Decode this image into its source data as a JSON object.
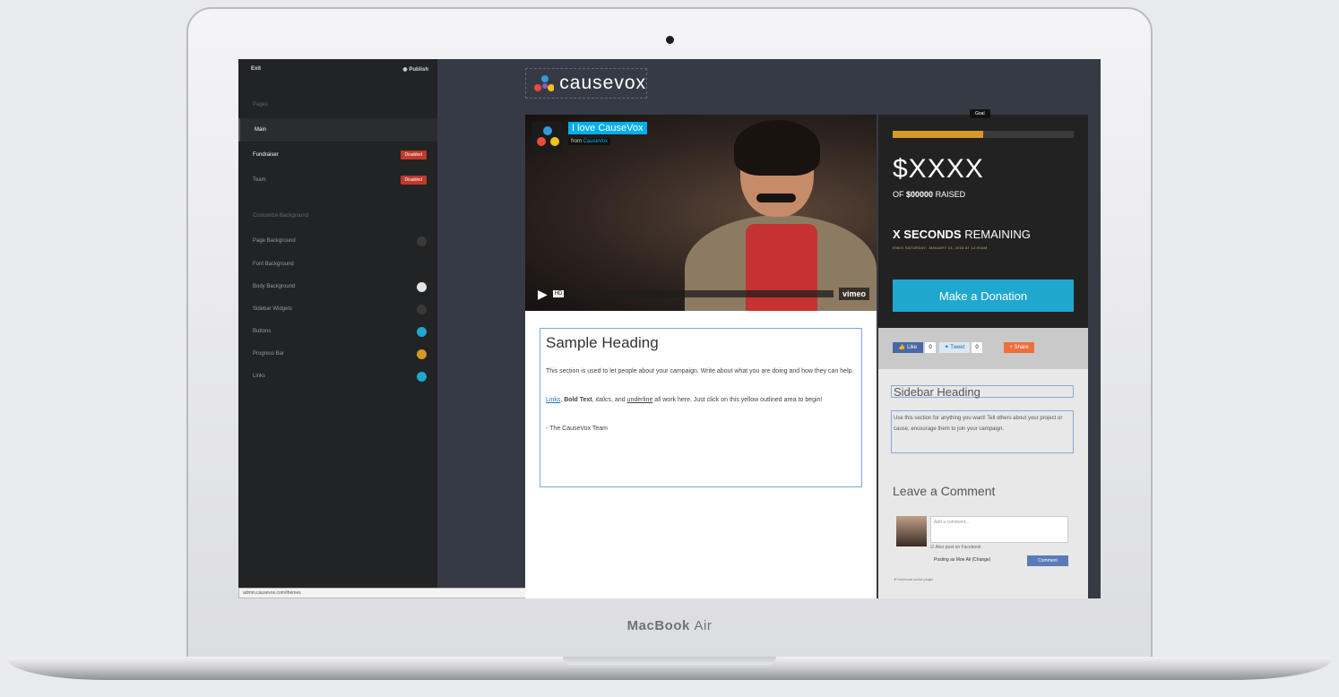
{
  "device": {
    "brand_bold": "MacBook",
    "brand_light": "Air"
  },
  "sidebar": {
    "top_left": "Exit",
    "top_right": "Publish",
    "top_right_icon": "eye-icon",
    "pages_label": "Pages",
    "items": [
      {
        "label": "Main",
        "active": true
      },
      {
        "label": "Fundraiser",
        "badge": "Disabled"
      },
      {
        "label": "Team",
        "badge": "Disabled"
      }
    ],
    "custom_heading": "Customize Background",
    "customize": [
      {
        "label": "Page Background",
        "color": "#3a3a3a"
      },
      {
        "label": "Font Background",
        "color": ""
      },
      {
        "label": "Body Background",
        "color": "#e4e4e4"
      },
      {
        "label": "Sidebar Widgets",
        "color": "#3a3a3a"
      },
      {
        "label": "Buttons",
        "color": "#1fa7cf"
      },
      {
        "label": "Progress Bar",
        "color": "#d59a25"
      },
      {
        "label": "Links",
        "color": "#1fa7cf"
      }
    ],
    "status_url": "admin.causevox.com/themes"
  },
  "logo": {
    "text": "causevox"
  },
  "video": {
    "title": "I love CauseVox",
    "from_prefix": "from",
    "from_name": "CauseVox",
    "hd": "HD",
    "vimeo": "vimeo"
  },
  "content": {
    "heading": "Sample Heading",
    "p1": "This section is used to let people about your campaign. Write about what you are doing and how they can help.",
    "links": "Links",
    "bold": "Bold Text",
    "italic": "italics",
    "underline": "underline",
    "p2_mid": ", and",
    "p2_end": " all work here. Just click on this yellow outlined area to begin!",
    "sign": "- The CauseVox Team"
  },
  "goal": {
    "tab": "Goal",
    "progress": 0.5,
    "amount": "$XXXX",
    "raised_of": "OF",
    "raised_value": "$00000",
    "raised_suffix": "RAISED",
    "remaining_bold": "X SECONDS",
    "remaining_rest": "REMAINING",
    "subline": "ENDS SATURDAY, JANUARY 23, 2016 AT 12:00AM",
    "donate": "Make a Donation"
  },
  "social": {
    "like": "Like",
    "like_count": "0",
    "tweet": "Tweet",
    "tweet_count": "0",
    "share": "Share"
  },
  "sidebar_widget": {
    "heading": "Sidebar Heading",
    "text": "Use this section for anything you want! Tell others about your project or cause, encourage them to join your campaign."
  },
  "comments": {
    "heading": "Leave a Comment",
    "placeholder": "Add a comment...",
    "also_post": "Also post on Facebook",
    "posting_as": "Posting as Moe Ali (Change)",
    "button": "Comment",
    "plugin": "Facebook social plugin"
  }
}
